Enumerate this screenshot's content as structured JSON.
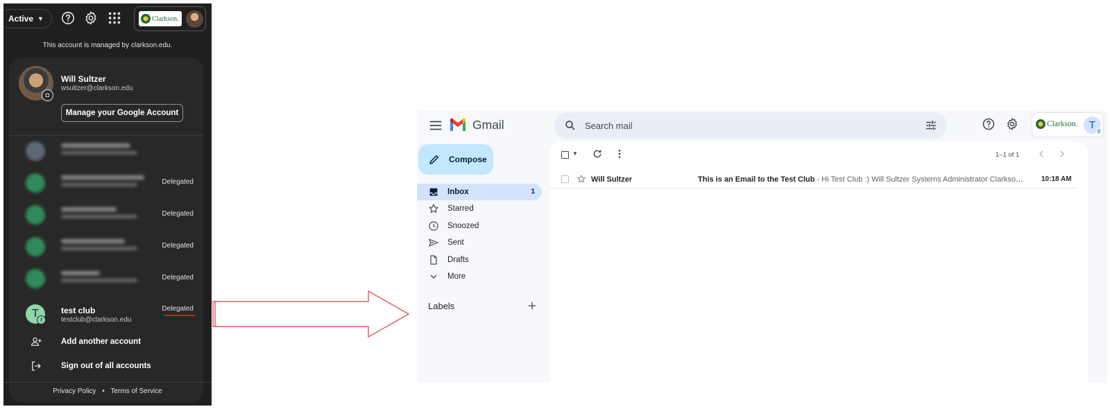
{
  "account_panel": {
    "status_label": "Active",
    "managed_note": "This account is managed by clarkson.edu.",
    "logo_text": "Clarkson.",
    "primary": {
      "name": "Will Sultzer",
      "email": "wsultzer@clarkson.edu",
      "manage_button": "Manage your Google Account"
    },
    "other_accounts": [
      {
        "badge": ""
      },
      {
        "badge": "Delegated"
      },
      {
        "badge": "Delegated"
      },
      {
        "badge": "Delegated"
      },
      {
        "badge": "Delegated"
      }
    ],
    "test_club": {
      "initial": "T",
      "name": "test club",
      "email": "testclub@clarkson.edu",
      "badge": "Delegated"
    },
    "add_account": "Add another account",
    "sign_out": "Sign out of all accounts",
    "footer": {
      "privacy": "Privacy Policy",
      "separator": "•",
      "terms": "Terms of Service"
    }
  },
  "gmail": {
    "app_name": "Gmail",
    "search_placeholder": "Search mail",
    "logo_text": "Clarkson.",
    "avatar_initial": "T",
    "compose": "Compose",
    "nav": [
      {
        "label": "Inbox",
        "count": "1",
        "active": true
      },
      {
        "label": "Starred",
        "count": ""
      },
      {
        "label": "Snoozed",
        "count": ""
      },
      {
        "label": "Sent",
        "count": ""
      },
      {
        "label": "Drafts",
        "count": ""
      },
      {
        "label": "More",
        "count": ""
      }
    ],
    "labels_title": "Labels",
    "page_range": "1–1 of 1",
    "message": {
      "sender": "Will Sultzer",
      "subject": "This is an Email to the Test Club",
      "snippet": " - Hi Test Club :) Will Sultzer Systems Administrator Clarkson University",
      "time": "10:18 AM"
    }
  },
  "colors": {
    "panel_bg": "#1f1f1f",
    "card_bg": "#282828",
    "arrow": "#e0393e",
    "compose_bg": "#c2e7ff",
    "nav_active": "#d3e3fd",
    "gmail_bg": "#f6f8fc"
  }
}
